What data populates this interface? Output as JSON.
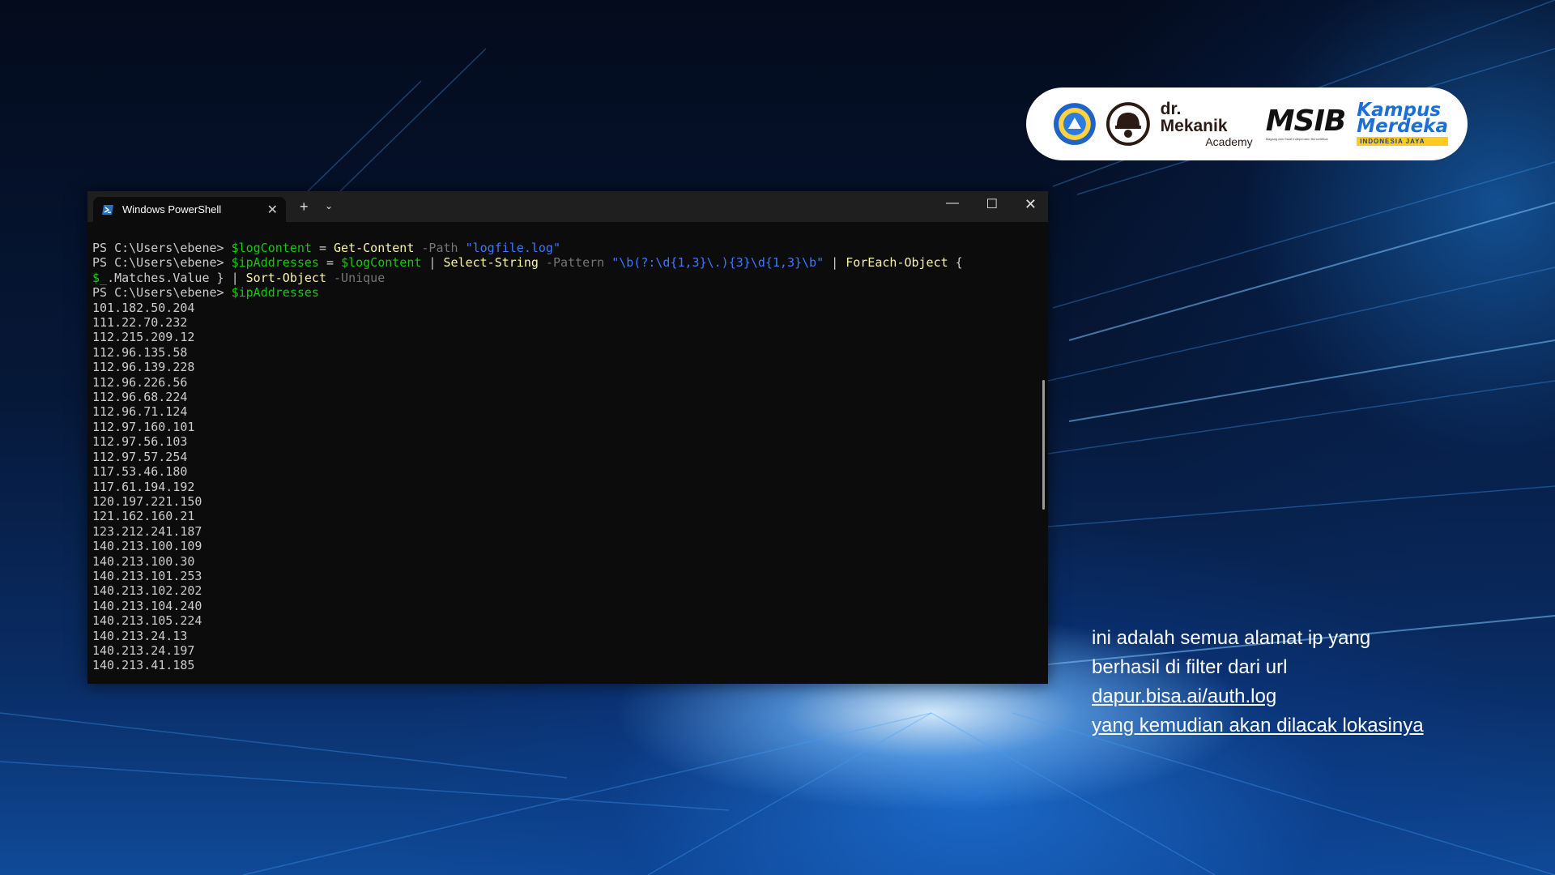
{
  "logos": {
    "dr_mekanik_title": "dr. Mekanik",
    "dr_mekanik_sub": "Academy",
    "msib": "MSIB",
    "msib_tagline": "Magang dan Studi Independen Bersertifikat",
    "kampus_line1": "Kampus",
    "kampus_line2": "Merdeka",
    "kampus_line3": "INDONESIA JAYA"
  },
  "terminal": {
    "tab_title": "Windows PowerShell",
    "tab_close": "✕",
    "new_tab": "+",
    "dropdown": "⌄",
    "minimize": "—",
    "maximize": "☐",
    "close": "✕",
    "prompt": "PS C:\\Users\\ebene> ",
    "cmd1": {
      "var": "$logContent",
      "eq": " = ",
      "cmdlet": "Get-Content",
      "param": " -Path ",
      "str": "\"logfile.log\""
    },
    "cmd2": {
      "var": "$ipAddresses",
      "eq": " = ",
      "var2": "$logContent",
      "pipe1": " | ",
      "cmdlet1": "Select-String",
      "param1": " -Pattern ",
      "str": "\"\\b(?:\\d{1,3}\\.){3}\\d{1,3}\\b\"",
      "pipe2": " | ",
      "cmdlet2": "ForEach-Object",
      "brace_open": " {",
      "var3": "$_",
      "member": ".Matches.Value } ",
      "pipe3": "| ",
      "cmdlet3": "Sort-Object",
      "param2": " -Unique"
    },
    "cmd3": {
      "var": "$ipAddresses"
    },
    "output": [
      "101.182.50.204",
      "111.22.70.232",
      "112.215.209.12",
      "112.96.135.58",
      "112.96.139.228",
      "112.96.226.56",
      "112.96.68.224",
      "112.96.71.124",
      "112.97.160.101",
      "112.97.56.103",
      "112.97.57.254",
      "117.53.46.180",
      "117.61.194.192",
      "120.197.221.150",
      "121.162.160.21",
      "123.212.241.187",
      "140.213.100.109",
      "140.213.100.30",
      "140.213.101.253",
      "140.213.102.202",
      "140.213.104.240",
      "140.213.105.224",
      "140.213.24.13",
      "140.213.24.197",
      "140.213.41.185"
    ]
  },
  "caption": {
    "line1": "ini adalah semua alamat ip yang",
    "line2": "berhasil di filter dari url",
    "line3": "dapur.bisa.ai/auth.log",
    "line4": "yang kemudian akan dilacak lokasinya"
  },
  "colors": {
    "terminal_bg": "#0c0c0c",
    "titlebar_bg": "#1f1f1f",
    "ps_variable": "#16c60c",
    "ps_cmdlet": "#f9f1a5",
    "ps_parameter": "#767676",
    "ps_string": "#3b78ff"
  }
}
